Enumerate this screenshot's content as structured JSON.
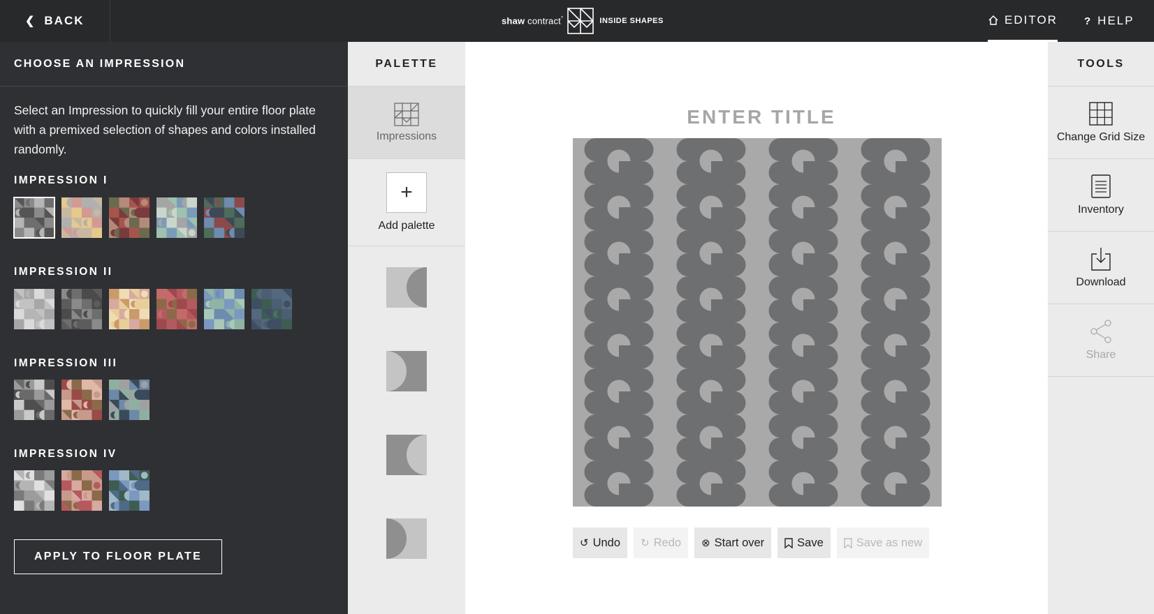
{
  "topbar": {
    "back_label": "BACK",
    "brand_shaw_bold": "shaw",
    "brand_shaw_light": "contract",
    "brand_tm": "°",
    "brand_product": "INSIDE SHAPES",
    "nav": [
      {
        "label": "EDITOR",
        "icon": "home-icon",
        "active": true
      },
      {
        "label": "HELP",
        "icon": "question-icon",
        "active": false
      }
    ]
  },
  "left_panel": {
    "heading": "CHOOSE AN IMPRESSION",
    "description": "Select an Impression to quickly fill your entire floor plate with a premixed selection of shapes and colors installed randomly.",
    "impressions": [
      {
        "title": "IMPRESSION I",
        "swatches": [
          [
            "#555",
            "#8a8a8a",
            "#b5b5b5",
            "#6e6e6e"
          ],
          [
            "#c9b8a0",
            "#e6c98c",
            "#d39a94",
            "#b0b0b0"
          ],
          [
            "#7a3b3e",
            "#a5554b",
            "#6b6a4e",
            "#b58a7a"
          ],
          [
            "#9ec1b0",
            "#7c9bb8",
            "#c9d6cc",
            "#a5a5a5"
          ],
          [
            "#3d4a56",
            "#4e6b5c",
            "#6f8bae",
            "#8b4a4a"
          ]
        ]
      },
      {
        "title": "IMPRESSION II",
        "swatches": [
          [
            "#c2c2c2",
            "#a7a7a7",
            "#dadada",
            "#b5b5b5"
          ],
          [
            "#5c5c5c",
            "#8a8a8a",
            "#6e6e6e",
            "#4b4b4b"
          ],
          [
            "#e8cf9a",
            "#d8a9a0",
            "#c99a6a",
            "#f0dcb4"
          ],
          [
            "#9e4850",
            "#b45a5e",
            "#8a6a48",
            "#c46a6a"
          ],
          [
            "#8fb3a4",
            "#7b98c0",
            "#a9c8b8",
            "#6c8db0"
          ],
          [
            "#3f4f62",
            "#3e5d52",
            "#4b5e74",
            "#55697e"
          ]
        ]
      },
      {
        "title": "IMPRESSION III",
        "swatches": [
          [
            "#6a6a6a",
            "#9a9a9a",
            "#c9c9c9",
            "#4e4e4e"
          ],
          [
            "#c89a8c",
            "#9a4a48",
            "#8a6a4a",
            "#e0b8a8"
          ],
          [
            "#3a4a5a",
            "#6c8aa8",
            "#8fb0a0",
            "#a0a0a0"
          ]
        ]
      },
      {
        "title": "IMPRESSION IV",
        "swatches": [
          [
            "#b5b5b5",
            "#e0e0e0",
            "#7a7a7a",
            "#9c9c9c"
          ],
          [
            "#b45a5e",
            "#d8a9a0",
            "#8a6a48",
            "#c99a8c"
          ],
          [
            "#4f6a86",
            "#3e5d52",
            "#7b98c0",
            "#a0b8c8"
          ]
        ]
      }
    ],
    "apply_label": "APPLY TO FLOOR PLATE"
  },
  "palette": {
    "heading": "PALETTE",
    "impressions_label": "Impressions",
    "add_label": "Add palette",
    "add_glyph": "+",
    "tiles": [
      "half-circle-right-dark",
      "half-circle-left-light",
      "half-circle-right-light",
      "half-circle-left-dark"
    ]
  },
  "canvas": {
    "title_placeholder": "ENTER TITLE",
    "title_value": "",
    "pattern": {
      "grid_columns": 8,
      "grid_rows": 8,
      "dark": "#6e6f71",
      "light": "#a9a9aa"
    },
    "actions": [
      {
        "label": "Undo",
        "icon": "undo-icon",
        "enabled": true
      },
      {
        "label": "Redo",
        "icon": "redo-icon",
        "enabled": false
      },
      {
        "label": "Start over",
        "icon": "x-circle-icon",
        "enabled": true
      },
      {
        "label": "Save",
        "icon": "bookmark-icon",
        "enabled": true
      },
      {
        "label": "Save as new",
        "icon": "bookmark-icon",
        "enabled": false
      }
    ]
  },
  "tools": {
    "heading": "TOOLS",
    "items": [
      {
        "label": "Change Grid Size",
        "icon": "grid-icon",
        "enabled": true
      },
      {
        "label": "Inventory",
        "icon": "document-icon",
        "enabled": true
      },
      {
        "label": "Download",
        "icon": "download-icon",
        "enabled": true
      },
      {
        "label": "Share",
        "icon": "share-icon",
        "enabled": false
      }
    ]
  }
}
